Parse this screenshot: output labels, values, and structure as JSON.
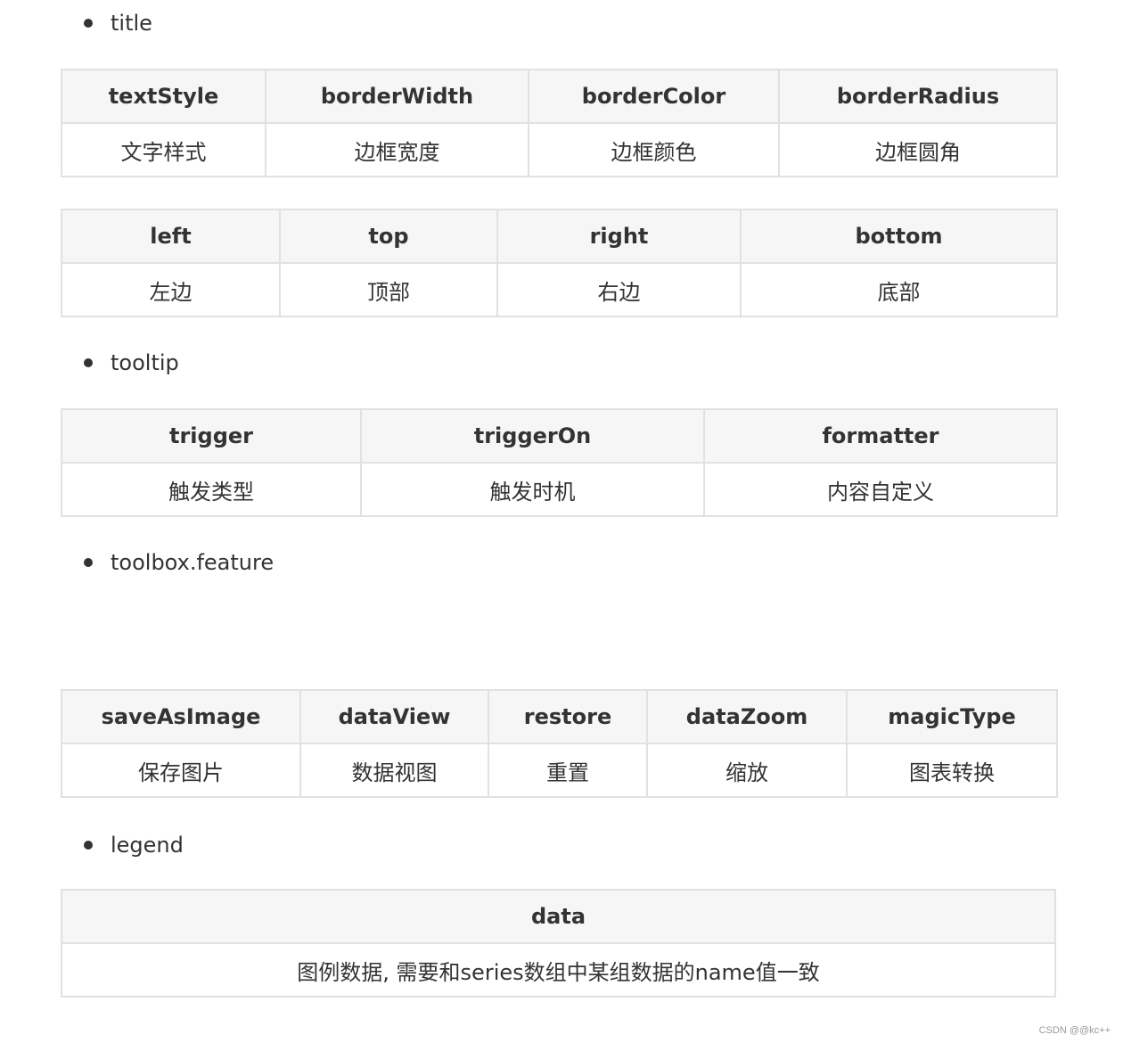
{
  "sections": [
    {
      "bullet": "title",
      "tables": [
        {
          "headers": [
            "textStyle",
            "borderWidth",
            "borderColor",
            "borderRadius"
          ],
          "values": [
            "文字样式",
            "边框宽度",
            "边框颜色",
            "边框圆角"
          ]
        },
        {
          "headers": [
            "left",
            "top",
            "right",
            "bottom"
          ],
          "values": [
            "左边",
            "顶部",
            "右边",
            "底部"
          ]
        }
      ]
    },
    {
      "bullet": "tooltip",
      "tables": [
        {
          "headers": [
            "trigger",
            "triggerOn",
            "formatter"
          ],
          "values": [
            "触发类型",
            "触发时机",
            "内容自定义"
          ]
        }
      ]
    },
    {
      "bullet": "toolbox.feature",
      "tables": [
        {
          "headers": [
            "saveAsImage",
            "dataView",
            "restore",
            "dataZoom",
            "magicType"
          ],
          "values": [
            "保存图片",
            "数据视图",
            "重置",
            "缩放",
            "图表转换"
          ]
        }
      ]
    },
    {
      "bullet": "legend",
      "tables": [
        {
          "headers": [
            "data"
          ],
          "values": [
            "图例数据, 需要和series数组中某组数据的name值一致"
          ]
        }
      ]
    }
  ],
  "watermark": "CSDN @@kc++"
}
